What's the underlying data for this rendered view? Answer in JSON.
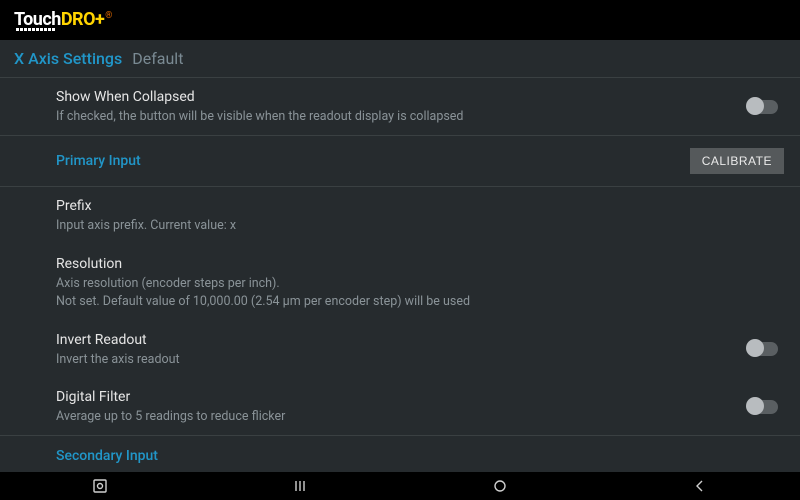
{
  "brand": {
    "part1": "Touch",
    "part2": "DRO",
    "plus": "+",
    "trade": "®"
  },
  "header": {
    "title": "X Axis Settings",
    "subtitle": "Default"
  },
  "groups": {
    "collapsed": {
      "title": "Show When Collapsed",
      "desc": "If checked, the button will be visible when the readout display is collapsed"
    },
    "primaryInput": {
      "label": "Primary Input",
      "calibrate": "CALIBRATE"
    },
    "prefix": {
      "title": "Prefix",
      "desc": "Input axis prefix. Current value: x"
    },
    "resolution": {
      "title": "Resolution",
      "desc1": "Axis resolution (encoder steps per inch).",
      "desc2": "Not set. Default value of 10,000.00 (2.54 µm per encoder step) will be used"
    },
    "invert": {
      "title": "Invert Readout",
      "desc": "Invert the axis readout"
    },
    "filter": {
      "title": "Digital Filter",
      "desc": "Average up to 5 readings to reduce flicker"
    },
    "secondaryInput": {
      "label": "Secondary Input"
    }
  }
}
